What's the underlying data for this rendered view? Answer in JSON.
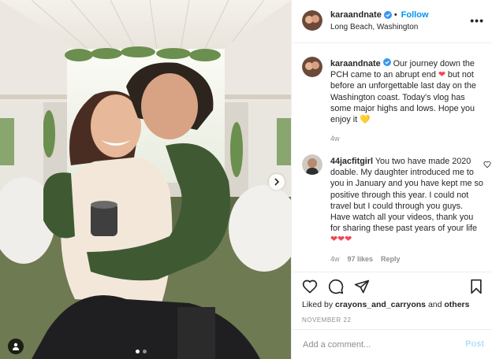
{
  "post": {
    "author": "karaandnate",
    "follow_label": "Follow",
    "location": "Long Beach, Washington",
    "more_label": "•••",
    "caption": {
      "username": "karaandnate",
      "text_1": "Our journey down the PCH came to an abrupt end",
      "emoji_1": "❤",
      "text_2": "but not before an unforgettable last day on the Washington coast. Today's vlog has some major highs and lows. Hope you enjoy it",
      "emoji_2": "💛",
      "age": "4w"
    },
    "comments": [
      {
        "username": "44jacfitgirl",
        "text": "You two have made 2020 doable. My daughter introduced me to you in January and you have kept me so positive through this year. I could not travel but I could through you guys. Have watch all your videos, thank you for sharing these past years of your life",
        "emoji": "❤❤❤",
        "age": "4w",
        "likes": "97 likes",
        "reply_label": "Reply"
      }
    ],
    "liked_by": {
      "prefix": "Liked by",
      "user": "crayons_and_carryons",
      "conj": "and",
      "others": "others"
    },
    "date": "NOVEMBER 22",
    "add_comment_placeholder": "Add a comment...",
    "post_label": "Post",
    "carousel": {
      "count": 2,
      "active": 1
    }
  },
  "colors": {
    "accent": "#0095f6",
    "heart": "#ed4956",
    "muted": "#8e8e8e",
    "post_disabled": "#b2dffc"
  },
  "icons": [
    "verified-badge-icon",
    "more-options-icon",
    "heart-icon",
    "comment-icon",
    "share-icon",
    "bookmark-icon",
    "chevron-right-icon",
    "user-tag-icon"
  ]
}
